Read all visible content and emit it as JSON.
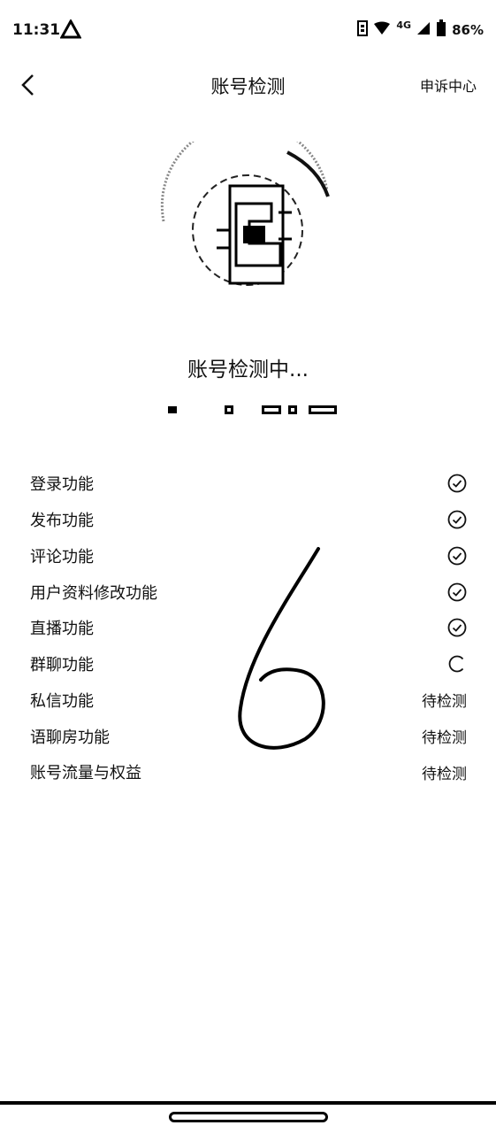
{
  "status_bar": {
    "time": "11:31",
    "network": "4G",
    "battery": "86%"
  },
  "header": {
    "title": "账号检测",
    "appeal_link": "申诉中心"
  },
  "detection": {
    "status_text": "账号检测中..."
  },
  "checks": [
    {
      "label": "登录功能",
      "state": "done"
    },
    {
      "label": "发布功能",
      "state": "done"
    },
    {
      "label": "评论功能",
      "state": "done"
    },
    {
      "label": "用户资料修改功能",
      "state": "done"
    },
    {
      "label": "直播功能",
      "state": "done"
    },
    {
      "label": "群聊功能",
      "state": "loading"
    },
    {
      "label": "私信功能",
      "state": "pending",
      "state_text": "待检测"
    },
    {
      "label": "语聊房功能",
      "state": "pending",
      "state_text": "待检测"
    },
    {
      "label": "账号流量与权益",
      "state": "pending",
      "state_text": "待检测"
    }
  ],
  "icons": {
    "back": "chevron-left-icon",
    "done": "check-circle-icon",
    "loading": "spinner-icon"
  }
}
